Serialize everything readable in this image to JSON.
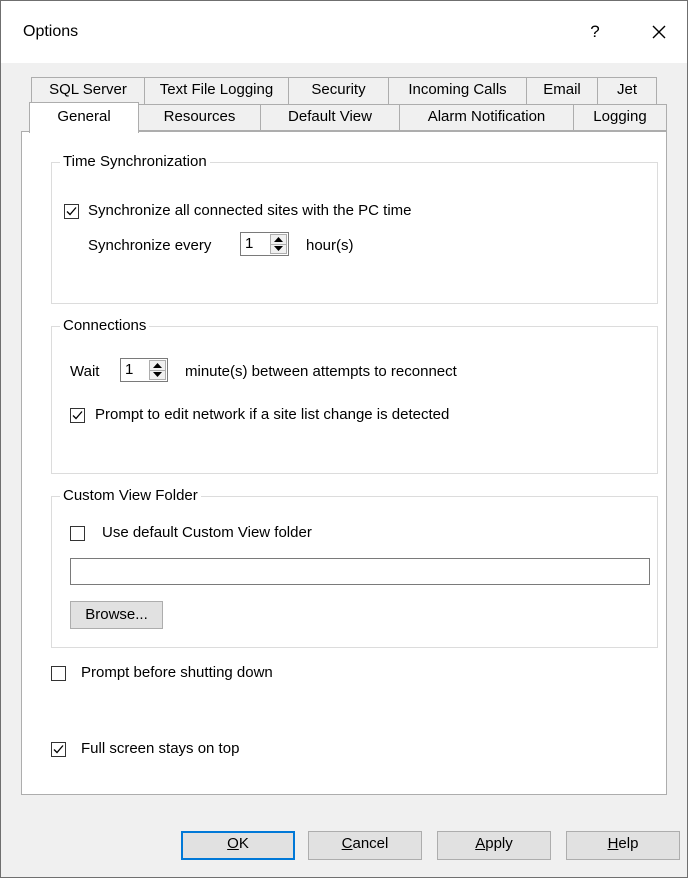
{
  "window": {
    "title": "Options",
    "help_label": "?"
  },
  "tabs": {
    "row1": [
      "SQL Server",
      "Text File Logging",
      "Security",
      "Incoming Calls",
      "Email",
      "Jet"
    ],
    "row2": [
      "General",
      "Resources",
      "Default View",
      "Alarm Notification",
      "Logging"
    ],
    "selected": "General"
  },
  "time_sync": {
    "title": "Time Synchronization",
    "sync_checkbox_label": "Synchronize all connected sites with the PC time",
    "sync_checked": true,
    "sync_every_label": "Synchronize every",
    "sync_every_value": "1",
    "sync_every_unit": "hour(s)"
  },
  "connections": {
    "title": "Connections",
    "wait_label": "Wait",
    "wait_value": "1",
    "wait_suffix": "minute(s) between attempts to reconnect",
    "prompt_label": "Prompt to edit network if a site list change is detected",
    "prompt_checked": true
  },
  "custom_view": {
    "title": "Custom View Folder",
    "use_default_label": "Use default Custom View folder",
    "use_default_checked": false,
    "folder_path": "",
    "browse_label": "Browse..."
  },
  "options": {
    "prompt_shutdown_label": "Prompt before shutting down",
    "prompt_shutdown_checked": false,
    "fullscreen_label": "Full screen stays on top",
    "fullscreen_checked": true
  },
  "footer": {
    "ok_label": "OK",
    "cancel_label": "Cancel",
    "apply_label": "Apply",
    "help_label": "Help"
  },
  "colors": {
    "accent": "#0078d7",
    "background": "#f0f0f0"
  }
}
